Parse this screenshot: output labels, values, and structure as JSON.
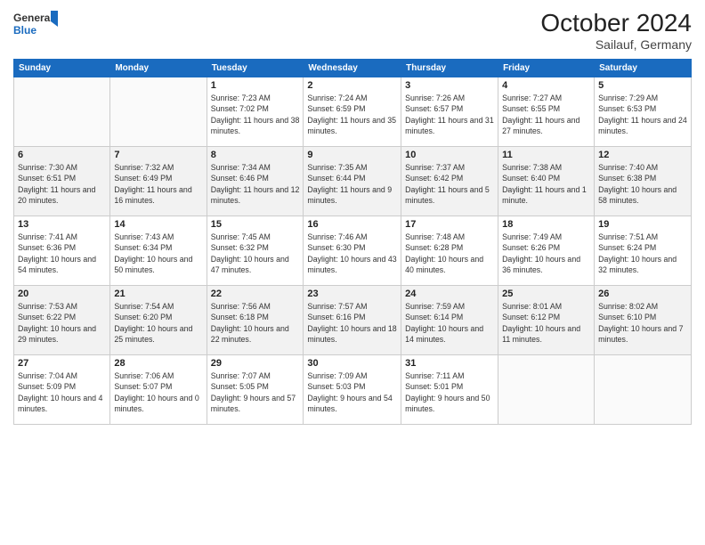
{
  "header": {
    "logo_line1": "General",
    "logo_line2": "Blue",
    "month": "October 2024",
    "location": "Sailauf, Germany"
  },
  "weekdays": [
    "Sunday",
    "Monday",
    "Tuesday",
    "Wednesday",
    "Thursday",
    "Friday",
    "Saturday"
  ],
  "weeks": [
    [
      {
        "day": "",
        "info": ""
      },
      {
        "day": "",
        "info": ""
      },
      {
        "day": "1",
        "info": "Sunrise: 7:23 AM\nSunset: 7:02 PM\nDaylight: 11 hours and 38 minutes."
      },
      {
        "day": "2",
        "info": "Sunrise: 7:24 AM\nSunset: 6:59 PM\nDaylight: 11 hours and 35 minutes."
      },
      {
        "day": "3",
        "info": "Sunrise: 7:26 AM\nSunset: 6:57 PM\nDaylight: 11 hours and 31 minutes."
      },
      {
        "day": "4",
        "info": "Sunrise: 7:27 AM\nSunset: 6:55 PM\nDaylight: 11 hours and 27 minutes."
      },
      {
        "day": "5",
        "info": "Sunrise: 7:29 AM\nSunset: 6:53 PM\nDaylight: 11 hours and 24 minutes."
      }
    ],
    [
      {
        "day": "6",
        "info": "Sunrise: 7:30 AM\nSunset: 6:51 PM\nDaylight: 11 hours and 20 minutes."
      },
      {
        "day": "7",
        "info": "Sunrise: 7:32 AM\nSunset: 6:49 PM\nDaylight: 11 hours and 16 minutes."
      },
      {
        "day": "8",
        "info": "Sunrise: 7:34 AM\nSunset: 6:46 PM\nDaylight: 11 hours and 12 minutes."
      },
      {
        "day": "9",
        "info": "Sunrise: 7:35 AM\nSunset: 6:44 PM\nDaylight: 11 hours and 9 minutes."
      },
      {
        "day": "10",
        "info": "Sunrise: 7:37 AM\nSunset: 6:42 PM\nDaylight: 11 hours and 5 minutes."
      },
      {
        "day": "11",
        "info": "Sunrise: 7:38 AM\nSunset: 6:40 PM\nDaylight: 11 hours and 1 minute."
      },
      {
        "day": "12",
        "info": "Sunrise: 7:40 AM\nSunset: 6:38 PM\nDaylight: 10 hours and 58 minutes."
      }
    ],
    [
      {
        "day": "13",
        "info": "Sunrise: 7:41 AM\nSunset: 6:36 PM\nDaylight: 10 hours and 54 minutes."
      },
      {
        "day": "14",
        "info": "Sunrise: 7:43 AM\nSunset: 6:34 PM\nDaylight: 10 hours and 50 minutes."
      },
      {
        "day": "15",
        "info": "Sunrise: 7:45 AM\nSunset: 6:32 PM\nDaylight: 10 hours and 47 minutes."
      },
      {
        "day": "16",
        "info": "Sunrise: 7:46 AM\nSunset: 6:30 PM\nDaylight: 10 hours and 43 minutes."
      },
      {
        "day": "17",
        "info": "Sunrise: 7:48 AM\nSunset: 6:28 PM\nDaylight: 10 hours and 40 minutes."
      },
      {
        "day": "18",
        "info": "Sunrise: 7:49 AM\nSunset: 6:26 PM\nDaylight: 10 hours and 36 minutes."
      },
      {
        "day": "19",
        "info": "Sunrise: 7:51 AM\nSunset: 6:24 PM\nDaylight: 10 hours and 32 minutes."
      }
    ],
    [
      {
        "day": "20",
        "info": "Sunrise: 7:53 AM\nSunset: 6:22 PM\nDaylight: 10 hours and 29 minutes."
      },
      {
        "day": "21",
        "info": "Sunrise: 7:54 AM\nSunset: 6:20 PM\nDaylight: 10 hours and 25 minutes."
      },
      {
        "day": "22",
        "info": "Sunrise: 7:56 AM\nSunset: 6:18 PM\nDaylight: 10 hours and 22 minutes."
      },
      {
        "day": "23",
        "info": "Sunrise: 7:57 AM\nSunset: 6:16 PM\nDaylight: 10 hours and 18 minutes."
      },
      {
        "day": "24",
        "info": "Sunrise: 7:59 AM\nSunset: 6:14 PM\nDaylight: 10 hours and 14 minutes."
      },
      {
        "day": "25",
        "info": "Sunrise: 8:01 AM\nSunset: 6:12 PM\nDaylight: 10 hours and 11 minutes."
      },
      {
        "day": "26",
        "info": "Sunrise: 8:02 AM\nSunset: 6:10 PM\nDaylight: 10 hours and 7 minutes."
      }
    ],
    [
      {
        "day": "27",
        "info": "Sunrise: 7:04 AM\nSunset: 5:09 PM\nDaylight: 10 hours and 4 minutes."
      },
      {
        "day": "28",
        "info": "Sunrise: 7:06 AM\nSunset: 5:07 PM\nDaylight: 10 hours and 0 minutes."
      },
      {
        "day": "29",
        "info": "Sunrise: 7:07 AM\nSunset: 5:05 PM\nDaylight: 9 hours and 57 minutes."
      },
      {
        "day": "30",
        "info": "Sunrise: 7:09 AM\nSunset: 5:03 PM\nDaylight: 9 hours and 54 minutes."
      },
      {
        "day": "31",
        "info": "Sunrise: 7:11 AM\nSunset: 5:01 PM\nDaylight: 9 hours and 50 minutes."
      },
      {
        "day": "",
        "info": ""
      },
      {
        "day": "",
        "info": ""
      }
    ]
  ]
}
